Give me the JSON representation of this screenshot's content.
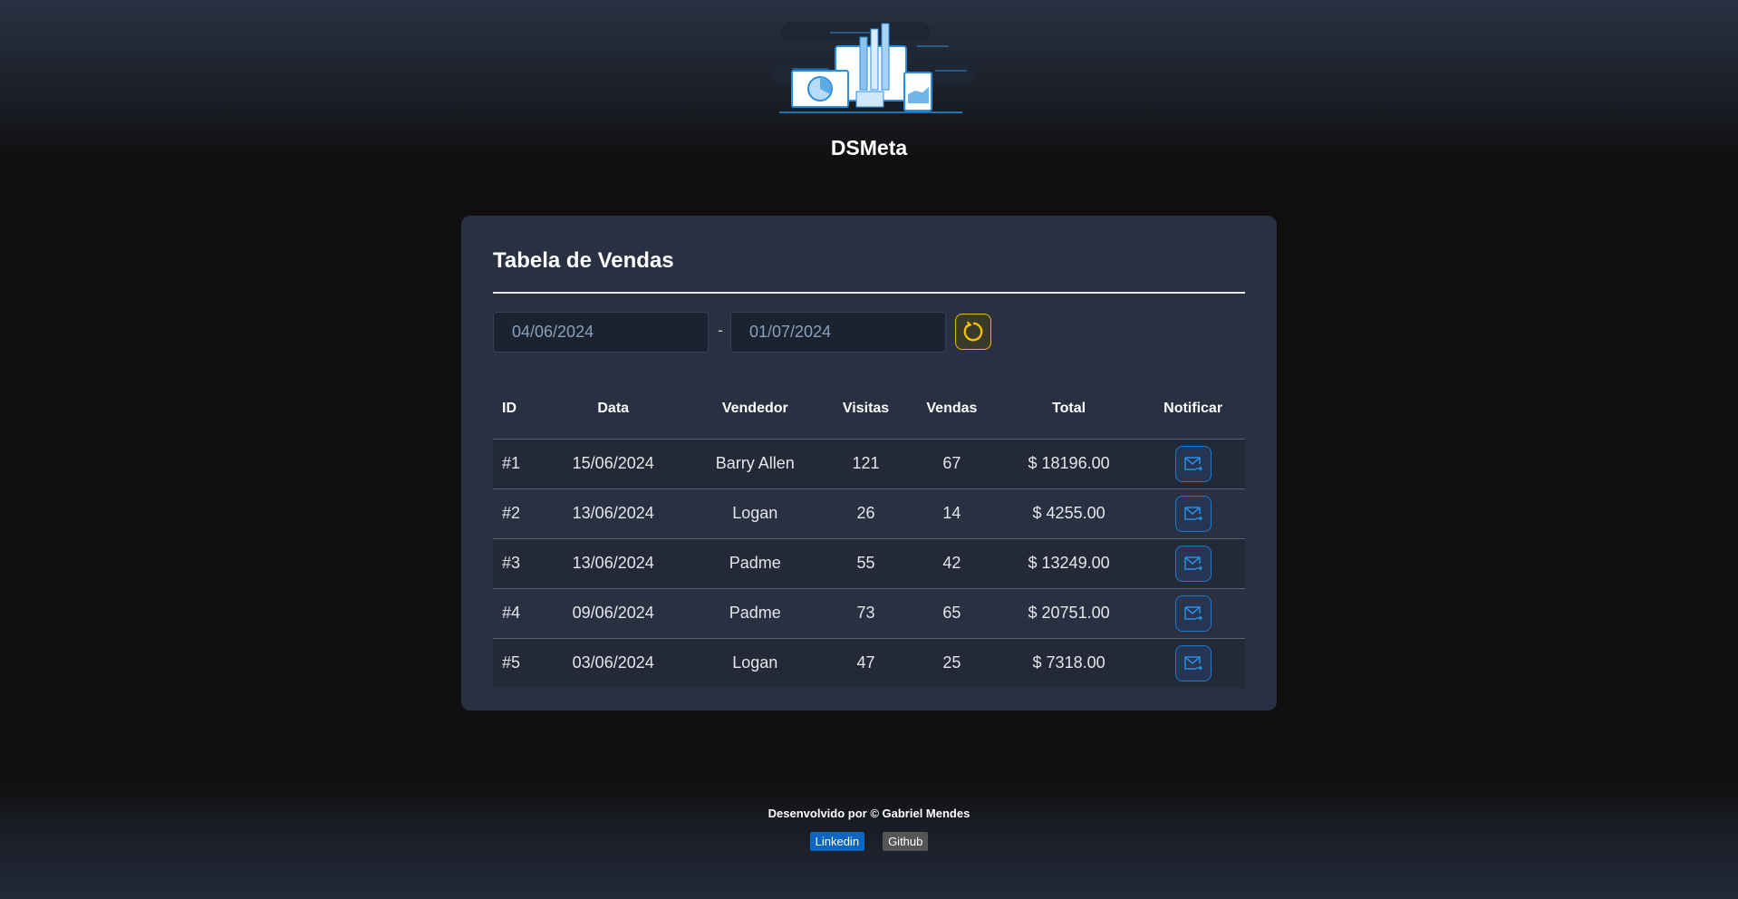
{
  "app": {
    "title": "DSMeta"
  },
  "card": {
    "title": "Tabela de Vendas",
    "date_min": "04/06/2024",
    "date_max": "01/07/2024",
    "separator": "-"
  },
  "table": {
    "headers": [
      "ID",
      "Data",
      "Vendedor",
      "Visitas",
      "Vendas",
      "Total",
      "Notificar"
    ],
    "rows": [
      {
        "id": "#1",
        "date": "15/06/2024",
        "seller": "Barry Allen",
        "visits": "121",
        "sales": "67",
        "total": "$ 18196.00"
      },
      {
        "id": "#2",
        "date": "13/06/2024",
        "seller": "Logan",
        "visits": "26",
        "sales": "14",
        "total": "$ 4255.00"
      },
      {
        "id": "#3",
        "date": "13/06/2024",
        "seller": "Padme",
        "visits": "55",
        "sales": "42",
        "total": "$ 13249.00"
      },
      {
        "id": "#4",
        "date": "09/06/2024",
        "seller": "Padme",
        "visits": "73",
        "sales": "65",
        "total": "$ 20751.00"
      },
      {
        "id": "#5",
        "date": "03/06/2024",
        "seller": "Logan",
        "visits": "47",
        "sales": "25",
        "total": "$ 7318.00"
      }
    ]
  },
  "footer": {
    "credit": "Desenvolvido por © Gabriel Mendes",
    "linkedin": "Linkedin",
    "github": "Github"
  },
  "colors": {
    "accent": "#1a7ad0",
    "refresh": "#e6b800",
    "card": "#283042"
  }
}
